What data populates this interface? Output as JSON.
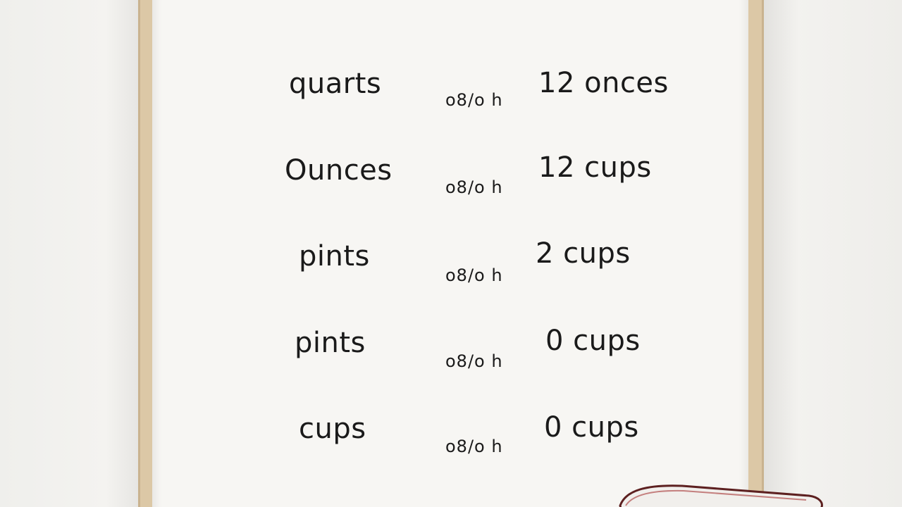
{
  "rows": [
    {
      "label": "quarts",
      "mid": "o8/o h",
      "value": "12 onces"
    },
    {
      "label": "Ounces",
      "mid": "o8/o h",
      "value": "12 cups"
    },
    {
      "label": "pints",
      "mid": "o8/o h",
      "value": "2 cups"
    },
    {
      "label": "pints",
      "mid": "o8/o h",
      "value": "0 cups"
    },
    {
      "label": "cups",
      "mid": "o8/o h",
      "value": "0 cups"
    }
  ],
  "colors": {
    "frame": "#dcc8a6",
    "paper": "#f7f6f3",
    "text": "#1a1a1a",
    "cup_rim": "#7a2a2a"
  }
}
